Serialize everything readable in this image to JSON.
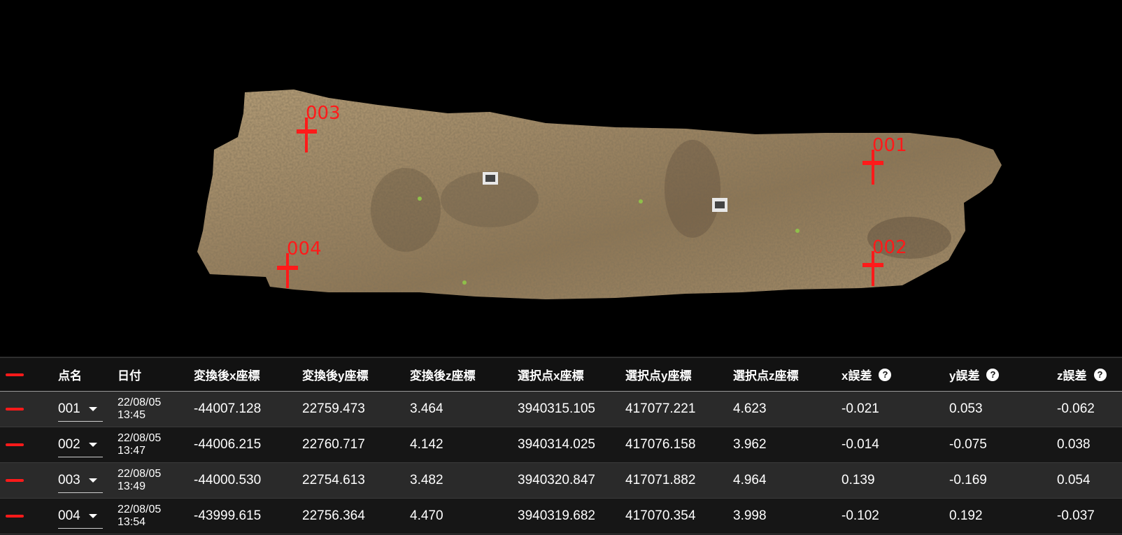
{
  "viewer": {
    "markers": [
      {
        "label": "003",
        "color": "#ff1a1a"
      },
      {
        "label": "001",
        "color": "#ff1a1a"
      },
      {
        "label": "004",
        "color": "#ff1a1a"
      },
      {
        "label": "002",
        "color": "#ff1a1a"
      }
    ]
  },
  "table": {
    "headers": {
      "name": "点名",
      "date": "日付",
      "tx": "変換後x座標",
      "ty": "変換後y座標",
      "tz": "変換後z座標",
      "sx": "選択点x座標",
      "sy": "選択点y座標",
      "sz": "選択点z座標",
      "ex": "x誤差",
      "ey": "y誤差",
      "ez": "z誤差"
    },
    "rows": [
      {
        "name": "001",
        "date1": "22/08/05",
        "date2": "13:45",
        "tx": "-44007.128",
        "ty": "22759.473",
        "tz": "3.464",
        "sx": "3940315.105",
        "sy": "417077.221",
        "sz": "4.623",
        "ex": "-0.021",
        "ey": "0.053",
        "ez": "-0.062"
      },
      {
        "name": "002",
        "date1": "22/08/05",
        "date2": "13:47",
        "tx": "-44006.215",
        "ty": "22760.717",
        "tz": "4.142",
        "sx": "3940314.025",
        "sy": "417076.158",
        "sz": "3.962",
        "ex": "-0.014",
        "ey": "-0.075",
        "ez": "0.038"
      },
      {
        "name": "003",
        "date1": "22/08/05",
        "date2": "13:49",
        "tx": "-44000.530",
        "ty": "22754.613",
        "tz": "3.482",
        "sx": "3940320.847",
        "sy": "417071.882",
        "sz": "4.964",
        "ex": "0.139",
        "ey": "-0.169",
        "ez": "0.054"
      },
      {
        "name": "004",
        "date1": "22/08/05",
        "date2": "13:54",
        "tx": "-43999.615",
        "ty": "22756.364",
        "tz": "4.470",
        "sx": "3940319.682",
        "sy": "417070.354",
        "sz": "3.998",
        "ex": "-0.102",
        "ey": "0.192",
        "ez": "-0.037"
      }
    ]
  },
  "colors": {
    "marker": "#ff1a1a",
    "terrain": "#a08a66"
  },
  "icons": {
    "help": "question-circle-icon",
    "dropdown": "caret-down-icon",
    "line": "red-line-icon"
  }
}
